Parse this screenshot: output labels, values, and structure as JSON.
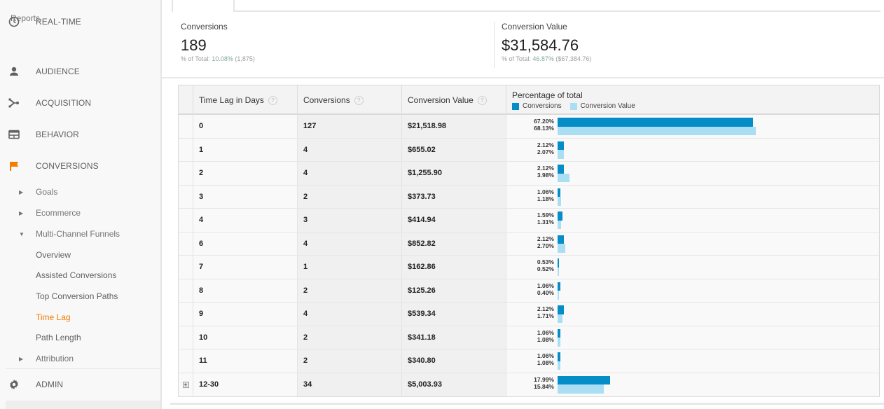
{
  "sidebar": {
    "section_label": "Reports",
    "top_items": [
      {
        "label": "REAL-TIME",
        "icon": "clock-icon"
      },
      {
        "label": "AUDIENCE",
        "icon": "person-icon"
      },
      {
        "label": "ACQUISITION",
        "icon": "acquisition-icon"
      },
      {
        "label": "BEHAVIOR",
        "icon": "behavior-icon"
      },
      {
        "label": "CONVERSIONS",
        "icon": "flag-icon"
      }
    ],
    "sub_items": [
      {
        "label": "Goals",
        "expander": "collapsed"
      },
      {
        "label": "Ecommerce",
        "expander": "collapsed"
      },
      {
        "label": "Multi-Channel Funnels",
        "expander": "expanded"
      },
      {
        "label": "Overview"
      },
      {
        "label": "Assisted Conversions"
      },
      {
        "label": "Top Conversion Paths"
      },
      {
        "label": "Time Lag",
        "active": true
      },
      {
        "label": "Path Length"
      },
      {
        "label": "Attribution",
        "expander": "collapsed"
      }
    ],
    "admin": {
      "label": "ADMIN",
      "icon": "gear-icon"
    },
    "active_color": "#f57c00"
  },
  "summary": {
    "conversions": {
      "label": "Conversions",
      "value": "189",
      "sub_prefix": "% of Total: ",
      "sub_pct": "10.08%",
      "sub_total": " (1,875)"
    },
    "conversion_value": {
      "label": "Conversion Value",
      "value": "$31,584.76",
      "sub_prefix": "% of Total: ",
      "sub_pct": "46.87%",
      "sub_total": " ($67,384.76)"
    }
  },
  "table": {
    "headers": {
      "time_lag": "Time Lag in Days",
      "conversions": "Conversions",
      "conversion_value": "Conversion Value",
      "percentage": "Percentage of total",
      "help": "?"
    },
    "legend": [
      {
        "label": "Conversions",
        "color": "#058dc7"
      },
      {
        "label": "Conversion Value",
        "color": "#aadff3"
      }
    ],
    "rows": [
      {
        "lag": "0",
        "conversions": "127",
        "value": "$21,518.98",
        "pct_conv": 67.2,
        "pct_val": 68.13
      },
      {
        "lag": "1",
        "conversions": "4",
        "value": "$655.02",
        "pct_conv": 2.12,
        "pct_val": 2.07
      },
      {
        "lag": "2",
        "conversions": "4",
        "value": "$1,255.90",
        "pct_conv": 2.12,
        "pct_val": 3.98
      },
      {
        "lag": "3",
        "conversions": "2",
        "value": "$373.73",
        "pct_conv": 1.06,
        "pct_val": 1.18
      },
      {
        "lag": "4",
        "conversions": "3",
        "value": "$414.94",
        "pct_conv": 1.59,
        "pct_val": 1.31
      },
      {
        "lag": "6",
        "conversions": "4",
        "value": "$852.82",
        "pct_conv": 2.12,
        "pct_val": 2.7
      },
      {
        "lag": "7",
        "conversions": "1",
        "value": "$162.86",
        "pct_conv": 0.53,
        "pct_val": 0.52
      },
      {
        "lag": "8",
        "conversions": "2",
        "value": "$125.26",
        "pct_conv": 1.06,
        "pct_val": 0.4
      },
      {
        "lag": "9",
        "conversions": "4",
        "value": "$539.34",
        "pct_conv": 2.12,
        "pct_val": 1.71
      },
      {
        "lag": "10",
        "conversions": "2",
        "value": "$341.18",
        "pct_conv": 1.06,
        "pct_val": 1.08
      },
      {
        "lag": "11",
        "conversions": "2",
        "value": "$340.80",
        "pct_conv": 1.06,
        "pct_val": 1.08
      },
      {
        "lag": "12-30",
        "conversions": "34",
        "value": "$5,003.93",
        "pct_conv": 17.99,
        "pct_val": 15.84,
        "expandable": true
      }
    ],
    "expand_glyph": "+"
  }
}
